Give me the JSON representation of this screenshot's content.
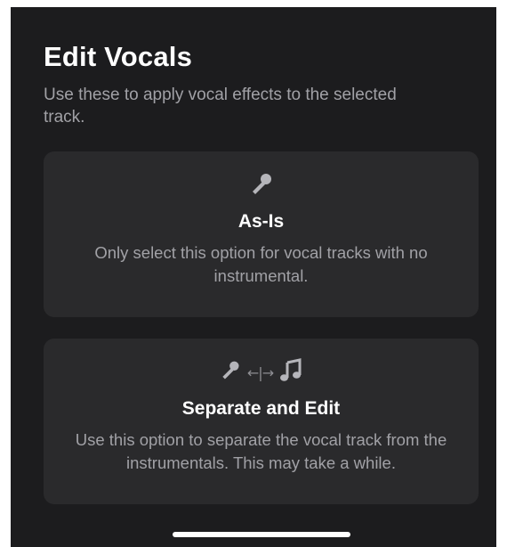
{
  "sheet": {
    "title": "Edit Vocals",
    "subtitle": "Use these to apply vocal effects to the selected track."
  },
  "options": [
    {
      "icon": "microphone-icon",
      "title": "As-Is",
      "description": "Only select this option for vocal tracks with no instrumental."
    },
    {
      "icons": [
        "microphone-icon",
        "split-arrows-icon",
        "music-notes-icon"
      ],
      "separator_glyph": "←|→",
      "title": "Separate and Edit",
      "description": "Use this option to separate the vocal track from the instrumentals. This may take a while."
    }
  ],
  "colors": {
    "background": "#1c1c1e",
    "card": "#2a2a2c",
    "title_text": "#ffffff",
    "secondary_text": "#a1a1a6"
  }
}
